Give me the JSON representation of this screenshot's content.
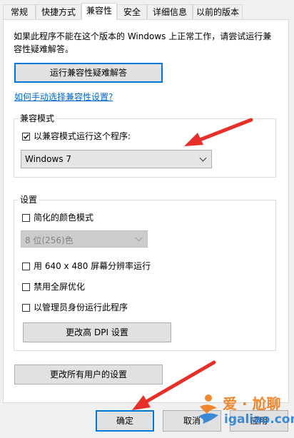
{
  "tabs": [
    {
      "label": "常规"
    },
    {
      "label": "快捷方式"
    },
    {
      "label": "兼容性"
    },
    {
      "label": "安全"
    },
    {
      "label": "详细信息"
    },
    {
      "label": "以前的版本"
    }
  ],
  "intro": {
    "line1": "如果此程序不能在这个版本的 Windows 上正常工作，请尝试运行兼",
    "line2": "容性疑难解答。"
  },
  "troubleshooter_button": "运行兼容性疑难解答",
  "manual_link": "如何手动选择兼容性设置?",
  "compat_mode": {
    "title": "兼容模式",
    "checkbox_label": "以兼容模式运行这个程序:",
    "checked": true,
    "selected_os": "Windows 7"
  },
  "settings": {
    "title": "设置",
    "reduced_color": "简化的颜色模式",
    "color_depth": "8 位(256)色",
    "res_640": "用 640 x 480 屏幕分辨率运行",
    "disable_fullscreen": "禁用全屏优化",
    "run_as_admin": "以管理员身份运行此程序",
    "dpi_button": "更改高 DPI 设置"
  },
  "all_users_button": "更改所有用户的设置",
  "footer": {
    "ok": "确定",
    "cancel": "取消",
    "apply": "应用"
  },
  "watermark": {
    "brand": "爱 · 尬聊",
    "url": "igaliao.com"
  },
  "colors": {
    "accent": "#0078d7",
    "annotation_arrow": "#e8302a",
    "watermark_orange": "#f07c1c",
    "watermark_blue": "#2a7fd4"
  }
}
